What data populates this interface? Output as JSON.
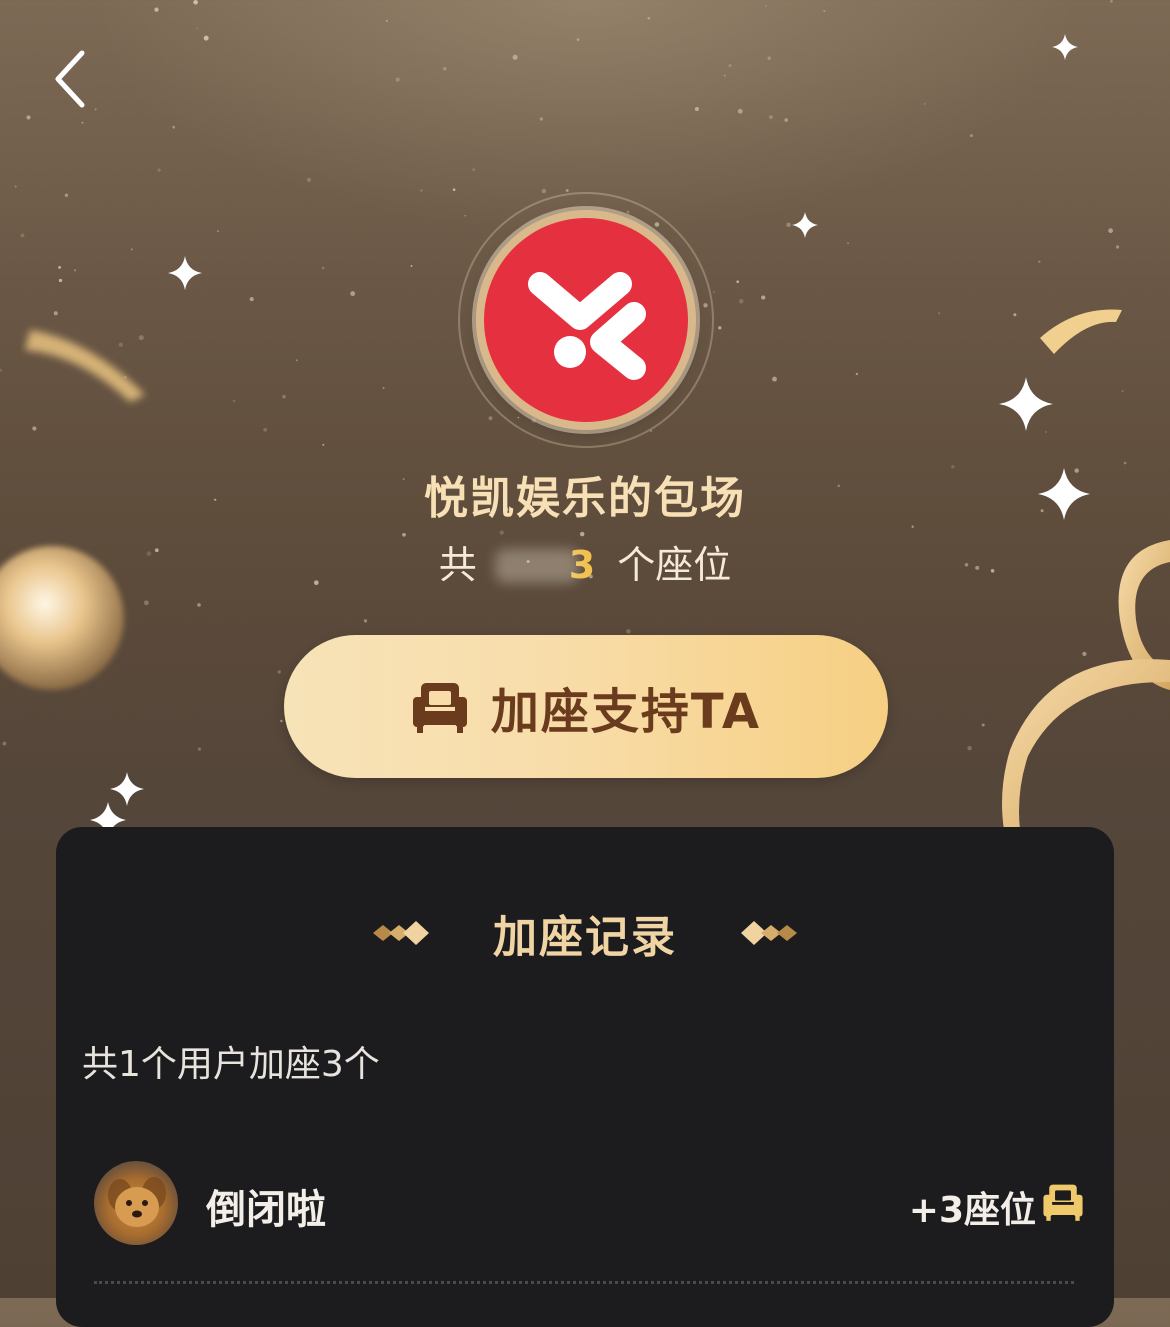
{
  "nav": {
    "back_icon": "chevron-left-icon"
  },
  "header": {
    "logo_icon": "yuekai-logo-icon",
    "title": "悦凯娱乐的包场",
    "seats_prefix": "共",
    "seats_visible_digit": "3",
    "seats_suffix": "个座位"
  },
  "cta": {
    "label": "加座支持TA",
    "icon": "sofa-icon"
  },
  "records": {
    "title": "加座记录",
    "summary": "共1个用户加座3个",
    "items": [
      {
        "username": "倒闭啦",
        "seats": "+3座位",
        "icon": "sofa-icon",
        "avatar": "dog-avatar"
      }
    ]
  },
  "colors": {
    "accent_gold": "#f0d4a3",
    "button_text": "#6b3b1d",
    "logo_red": "#e5313f",
    "panel_bg": "#1c1c1f"
  }
}
